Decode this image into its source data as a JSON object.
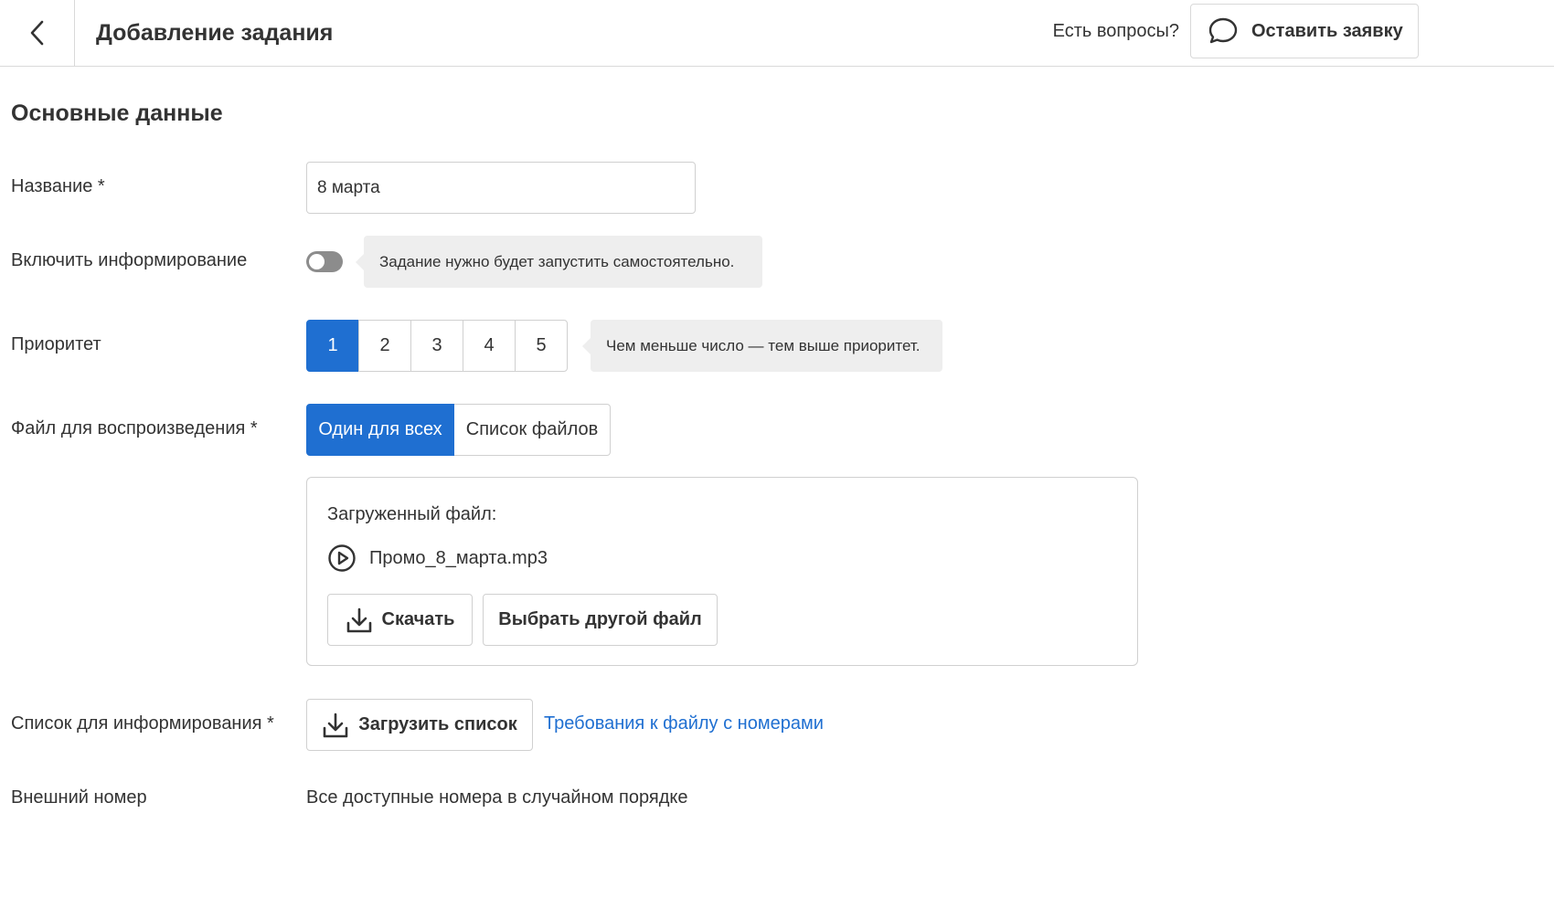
{
  "header": {
    "title": "Добавление задания",
    "questions_text": "Есть вопросы?",
    "request_button": "Оставить заявку"
  },
  "section": {
    "title": "Основные данные"
  },
  "form": {
    "name": {
      "label": "Название *",
      "value": "8 марта"
    },
    "notify": {
      "label": "Включить информирование",
      "enabled": false,
      "hint": "Задание нужно будет запустить самостоятельно."
    },
    "priority": {
      "label": "Приоритет",
      "options": [
        "1",
        "2",
        "3",
        "4",
        "5"
      ],
      "selected": "1",
      "hint": "Чем меньше число — тем выше приоритет."
    },
    "playback_file": {
      "label": "Файл для воспроизведения *",
      "modes": [
        "Один для всех",
        "Список файлов"
      ],
      "selected_mode": "Один для всех",
      "uploaded_label": "Загруженный файл:",
      "file_name": "Промо_8_марта.mp3",
      "download_button": "Скачать",
      "choose_other_button": "Выбрать другой файл"
    },
    "notify_list": {
      "label": "Список для информирования *",
      "upload_button": "Загрузить список",
      "requirements_link": "Требования к файлу с номерами"
    },
    "external_number": {
      "label": "Внешний номер",
      "value": "Все доступные номера в случайном порядке"
    }
  },
  "colors": {
    "accent": "#1f6fd1",
    "border": "#d0d0d0",
    "hint_bg": "#eeeeee",
    "toggle_off": "#8c8c8c"
  }
}
